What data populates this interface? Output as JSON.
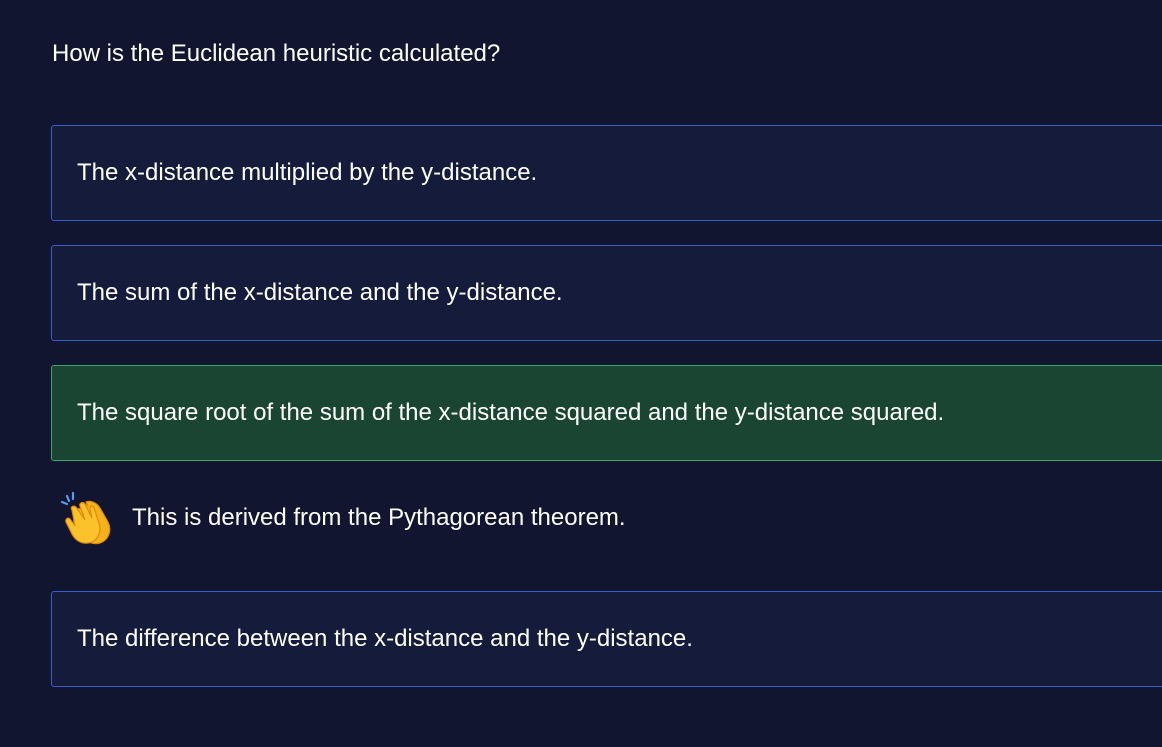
{
  "question": {
    "text": "How is the Euclidean heuristic calculated?"
  },
  "options": [
    {
      "text": "The x-distance multiplied by the y-distance.",
      "state": "default"
    },
    {
      "text": "The sum of the x-distance and the y-distance.",
      "state": "default"
    },
    {
      "text": "The square root of the sum of the x-distance squared and the y-distance squared.",
      "state": "correct"
    },
    {
      "text": "The difference between the x-distance and the y-distance.",
      "state": "default"
    }
  ],
  "feedback": {
    "icon": "clapping-hands-icon",
    "text": "This is derived from the Pythagorean theorem."
  },
  "colors": {
    "background": "#111530",
    "option_background": "#151b3b",
    "option_border": "#3a5cc7",
    "correct_background": "#1a4532",
    "correct_border": "#3aa66a"
  }
}
